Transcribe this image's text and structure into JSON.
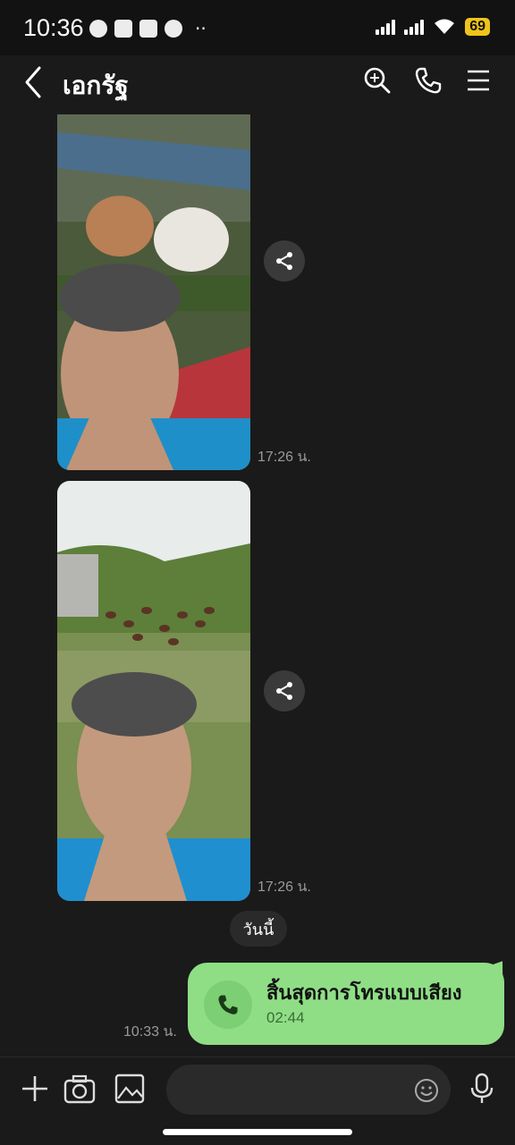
{
  "status": {
    "time": "10:36",
    "battery": "69"
  },
  "header": {
    "title": "เอกรัฐ"
  },
  "messages": [
    {
      "type": "photo",
      "time": "17:26 น."
    },
    {
      "type": "photo",
      "time": "17:26 น."
    }
  ],
  "date_separator": "วันนี้",
  "call": {
    "title": "สิ้นสุดการโทรแบบเสียง",
    "duration": "02:44",
    "time": "10:33 น."
  },
  "input": {
    "placeholder": ""
  },
  "colors": {
    "background": "#1a1a1a",
    "bubble_green": "#8fde86",
    "battery": "#f0c419"
  }
}
